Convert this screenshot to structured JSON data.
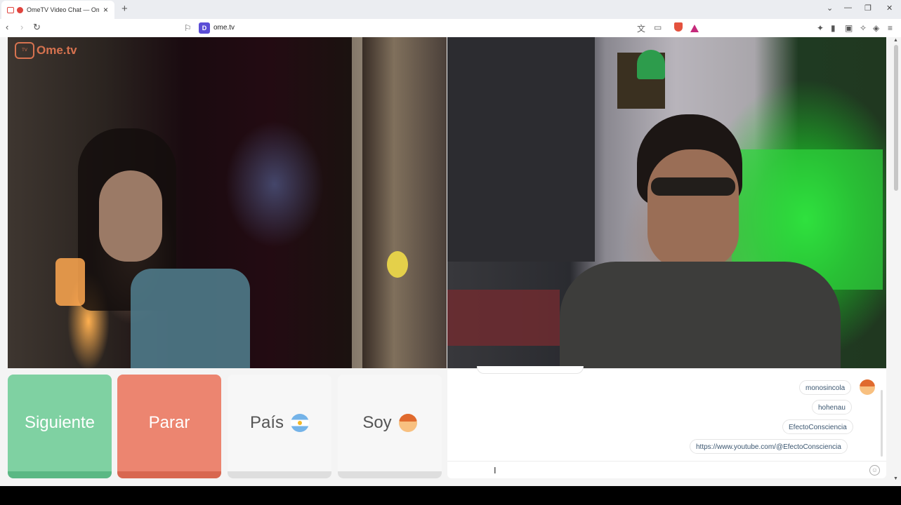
{
  "browser": {
    "tab_title": "OmeTV Video Chat — Omeg",
    "tab_close": "×",
    "new_tab": "+",
    "url": "ome.tv",
    "site_icon_letter": "D",
    "window_controls": {
      "menu": "⌄",
      "minimize": "—",
      "restore": "❐",
      "close": "✕"
    }
  },
  "page": {
    "logo_text": "Ome.tv",
    "logo_tv": "TV"
  },
  "controls": {
    "next_label": "Siguiente",
    "stop_label": "Parar",
    "country_label": "País",
    "iam_label": "Soy"
  },
  "chat": {
    "messages": [
      "monosincola",
      "hohenau",
      "EfectoConsciencia",
      "https://www.youtube.com/@EfectoConsciencia"
    ]
  },
  "colors": {
    "next": "#7fd1a2",
    "stop": "#ec8570",
    "logo": "#e87a54"
  }
}
